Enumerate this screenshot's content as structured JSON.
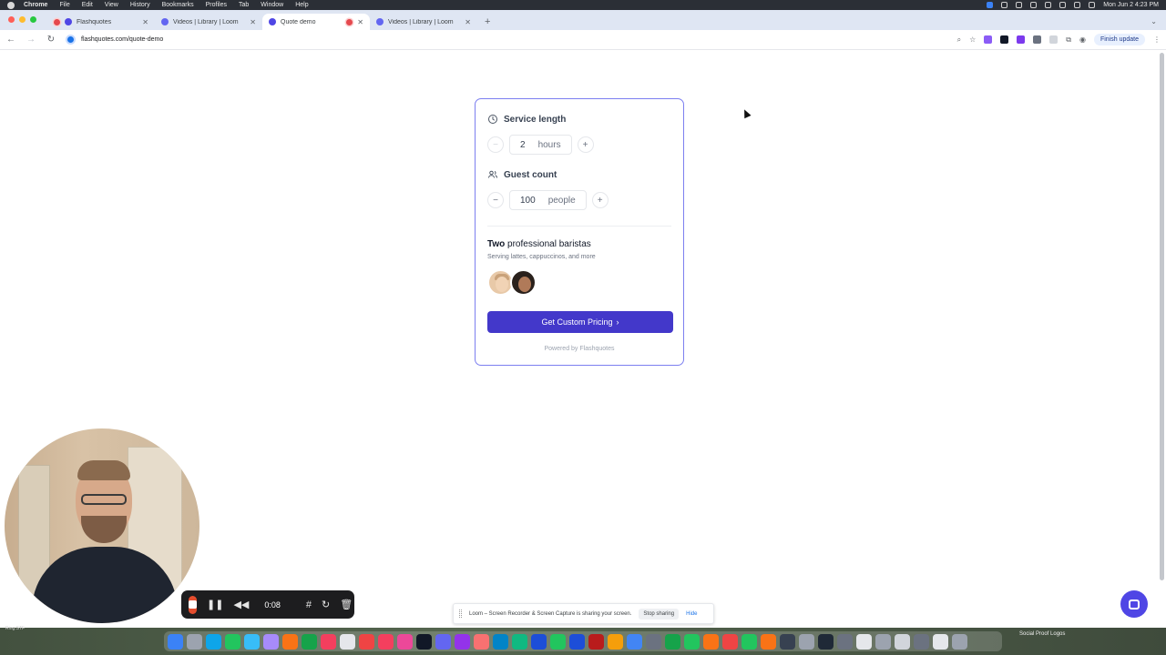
{
  "menubar": {
    "app": "Chrome",
    "items": [
      "File",
      "Edit",
      "View",
      "History",
      "Bookmarks",
      "Profiles",
      "Tab",
      "Window",
      "Help"
    ],
    "clock": "Mon Jun 2  4:23 PM"
  },
  "tabs": [
    {
      "title": "Flashquotes",
      "favicon_color": "#4f46e5",
      "active": false,
      "recording": false
    },
    {
      "title": "Videos | Library | Loom",
      "favicon_color": "#6366f1",
      "active": false,
      "recording": false
    },
    {
      "title": "Quote demo",
      "favicon_color": "#4f46e5",
      "active": true,
      "recording": true
    },
    {
      "title": "Videos | Library | Loom",
      "favicon_color": "#6366f1",
      "active": false,
      "recording": false
    }
  ],
  "toolbar": {
    "url": "flashquotes.com/quote-demo",
    "finish_update": "Finish update",
    "extensions": [
      "#8b5cf6",
      "#111827",
      "#7c3aed",
      "#6b7280",
      "#d1d5db"
    ]
  },
  "quote": {
    "service_length": {
      "label": "Service length",
      "value": "2",
      "unit": "hours",
      "minus_enabled": false
    },
    "guest_count": {
      "label": "Guest count",
      "value": "100",
      "unit": "people",
      "minus_enabled": true
    },
    "baristas": {
      "count_word": "Two",
      "title_rest": " professional baristas",
      "subtitle": "Serving lattes, cappuccinos, and more"
    },
    "cta_label": "Get Custom Pricing",
    "powered_by": "Powered by Flashquotes",
    "accent_color": "#4338ca",
    "border_color": "#7c7ff0"
  },
  "loom": {
    "timer": "0:08",
    "banner_text": "Loom – Screen Recorder & Screen Capture is sharing your screen.",
    "stop_sharing": "Stop sharing",
    "hide": "Hide"
  },
  "dock": {
    "icon_colors": [
      "#3b82f6",
      "#9ca3af",
      "#0ea5e9",
      "#22c55e",
      "#38bdf8",
      "#a78bfa",
      "#f97316",
      "#16a34a",
      "#f43f5e",
      "#e5e7eb",
      "#ef4444",
      "#f43f5e",
      "#ec4899",
      "#111827",
      "#6366f1",
      "#9333ea",
      "#f87171",
      "#0284c7",
      "#10b981",
      "#1d4ed8",
      "#22c55e",
      "#1d4ed8",
      "#b91c1c",
      "#f59e0b",
      "#4285f4",
      "#6b7280",
      "#16a34a",
      "#22c55e",
      "#f97316",
      "#ef4444",
      "#22c55e",
      "#f97316",
      "#374151",
      "#9ca3af",
      "#1f2937",
      "#6b7280",
      "#e5e7eb",
      "#9ca3af",
      "#d1d5db",
      "#6b7280",
      "#e5e7eb",
      "#9ca3af"
    ],
    "folder_label": "Social Proof Logos",
    "left_label": "Ring.STF"
  }
}
